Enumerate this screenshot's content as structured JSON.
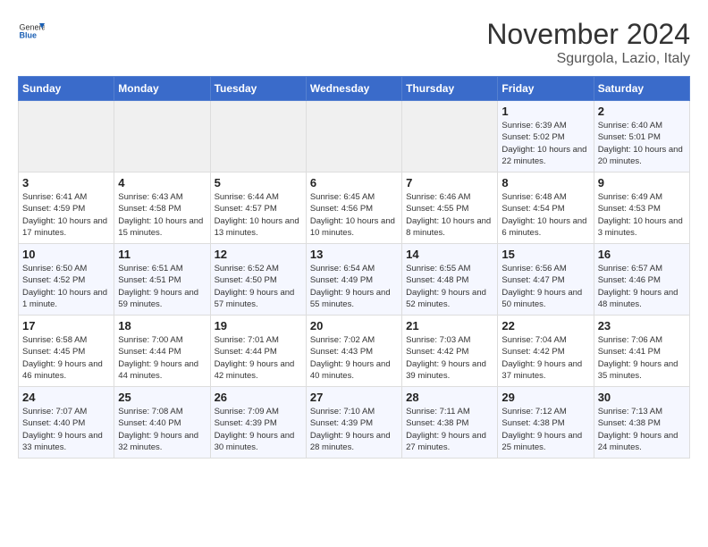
{
  "header": {
    "logo": {
      "general": "General",
      "blue": "Blue"
    },
    "title": "November 2024",
    "location": "Sgurgola, Lazio, Italy"
  },
  "calendar": {
    "weekdays": [
      "Sunday",
      "Monday",
      "Tuesday",
      "Wednesday",
      "Thursday",
      "Friday",
      "Saturday"
    ],
    "weeks": [
      [
        {
          "day": "",
          "empty": true
        },
        {
          "day": "",
          "empty": true
        },
        {
          "day": "",
          "empty": true
        },
        {
          "day": "",
          "empty": true
        },
        {
          "day": "",
          "empty": true
        },
        {
          "day": "1",
          "sunrise": "6:39 AM",
          "sunset": "5:02 PM",
          "daylight": "10 hours and 22 minutes."
        },
        {
          "day": "2",
          "sunrise": "6:40 AM",
          "sunset": "5:01 PM",
          "daylight": "10 hours and 20 minutes."
        }
      ],
      [
        {
          "day": "3",
          "sunrise": "6:41 AM",
          "sunset": "4:59 PM",
          "daylight": "10 hours and 17 minutes."
        },
        {
          "day": "4",
          "sunrise": "6:43 AM",
          "sunset": "4:58 PM",
          "daylight": "10 hours and 15 minutes."
        },
        {
          "day": "5",
          "sunrise": "6:44 AM",
          "sunset": "4:57 PM",
          "daylight": "10 hours and 13 minutes."
        },
        {
          "day": "6",
          "sunrise": "6:45 AM",
          "sunset": "4:56 PM",
          "daylight": "10 hours and 10 minutes."
        },
        {
          "day": "7",
          "sunrise": "6:46 AM",
          "sunset": "4:55 PM",
          "daylight": "10 hours and 8 minutes."
        },
        {
          "day": "8",
          "sunrise": "6:48 AM",
          "sunset": "4:54 PM",
          "daylight": "10 hours and 6 minutes."
        },
        {
          "day": "9",
          "sunrise": "6:49 AM",
          "sunset": "4:53 PM",
          "daylight": "10 hours and 3 minutes."
        }
      ],
      [
        {
          "day": "10",
          "sunrise": "6:50 AM",
          "sunset": "4:52 PM",
          "daylight": "10 hours and 1 minute."
        },
        {
          "day": "11",
          "sunrise": "6:51 AM",
          "sunset": "4:51 PM",
          "daylight": "9 hours and 59 minutes."
        },
        {
          "day": "12",
          "sunrise": "6:52 AM",
          "sunset": "4:50 PM",
          "daylight": "9 hours and 57 minutes."
        },
        {
          "day": "13",
          "sunrise": "6:54 AM",
          "sunset": "4:49 PM",
          "daylight": "9 hours and 55 minutes."
        },
        {
          "day": "14",
          "sunrise": "6:55 AM",
          "sunset": "4:48 PM",
          "daylight": "9 hours and 52 minutes."
        },
        {
          "day": "15",
          "sunrise": "6:56 AM",
          "sunset": "4:47 PM",
          "daylight": "9 hours and 50 minutes."
        },
        {
          "day": "16",
          "sunrise": "6:57 AM",
          "sunset": "4:46 PM",
          "daylight": "9 hours and 48 minutes."
        }
      ],
      [
        {
          "day": "17",
          "sunrise": "6:58 AM",
          "sunset": "4:45 PM",
          "daylight": "9 hours and 46 minutes."
        },
        {
          "day": "18",
          "sunrise": "7:00 AM",
          "sunset": "4:44 PM",
          "daylight": "9 hours and 44 minutes."
        },
        {
          "day": "19",
          "sunrise": "7:01 AM",
          "sunset": "4:44 PM",
          "daylight": "9 hours and 42 minutes."
        },
        {
          "day": "20",
          "sunrise": "7:02 AM",
          "sunset": "4:43 PM",
          "daylight": "9 hours and 40 minutes."
        },
        {
          "day": "21",
          "sunrise": "7:03 AM",
          "sunset": "4:42 PM",
          "daylight": "9 hours and 39 minutes."
        },
        {
          "day": "22",
          "sunrise": "7:04 AM",
          "sunset": "4:42 PM",
          "daylight": "9 hours and 37 minutes."
        },
        {
          "day": "23",
          "sunrise": "7:06 AM",
          "sunset": "4:41 PM",
          "daylight": "9 hours and 35 minutes."
        }
      ],
      [
        {
          "day": "24",
          "sunrise": "7:07 AM",
          "sunset": "4:40 PM",
          "daylight": "9 hours and 33 minutes."
        },
        {
          "day": "25",
          "sunrise": "7:08 AM",
          "sunset": "4:40 PM",
          "daylight": "9 hours and 32 minutes."
        },
        {
          "day": "26",
          "sunrise": "7:09 AM",
          "sunset": "4:39 PM",
          "daylight": "9 hours and 30 minutes."
        },
        {
          "day": "27",
          "sunrise": "7:10 AM",
          "sunset": "4:39 PM",
          "daylight": "9 hours and 28 minutes."
        },
        {
          "day": "28",
          "sunrise": "7:11 AM",
          "sunset": "4:38 PM",
          "daylight": "9 hours and 27 minutes."
        },
        {
          "day": "29",
          "sunrise": "7:12 AM",
          "sunset": "4:38 PM",
          "daylight": "9 hours and 25 minutes."
        },
        {
          "day": "30",
          "sunrise": "7:13 AM",
          "sunset": "4:38 PM",
          "daylight": "9 hours and 24 minutes."
        }
      ]
    ]
  }
}
